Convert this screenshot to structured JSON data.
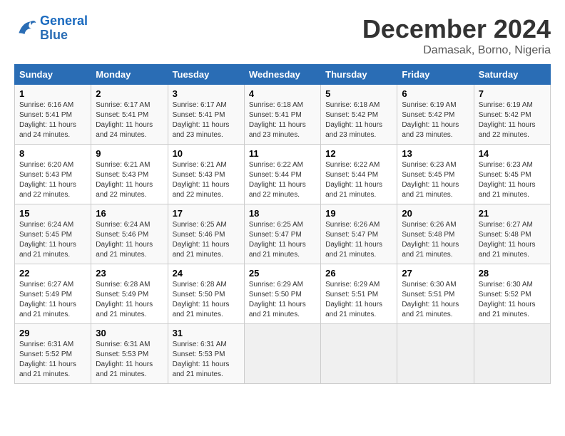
{
  "header": {
    "logo_line1": "General",
    "logo_line2": "Blue",
    "month": "December 2024",
    "location": "Damasak, Borno, Nigeria"
  },
  "calendar": {
    "days_of_week": [
      "Sunday",
      "Monday",
      "Tuesday",
      "Wednesday",
      "Thursday",
      "Friday",
      "Saturday"
    ],
    "weeks": [
      [
        {
          "day": "1",
          "info": "Sunrise: 6:16 AM\nSunset: 5:41 PM\nDaylight: 11 hours and 24 minutes."
        },
        {
          "day": "2",
          "info": "Sunrise: 6:17 AM\nSunset: 5:41 PM\nDaylight: 11 hours and 24 minutes."
        },
        {
          "day": "3",
          "info": "Sunrise: 6:17 AM\nSunset: 5:41 PM\nDaylight: 11 hours and 23 minutes."
        },
        {
          "day": "4",
          "info": "Sunrise: 6:18 AM\nSunset: 5:41 PM\nDaylight: 11 hours and 23 minutes."
        },
        {
          "day": "5",
          "info": "Sunrise: 6:18 AM\nSunset: 5:42 PM\nDaylight: 11 hours and 23 minutes."
        },
        {
          "day": "6",
          "info": "Sunrise: 6:19 AM\nSunset: 5:42 PM\nDaylight: 11 hours and 23 minutes."
        },
        {
          "day": "7",
          "info": "Sunrise: 6:19 AM\nSunset: 5:42 PM\nDaylight: 11 hours and 22 minutes."
        }
      ],
      [
        {
          "day": "8",
          "info": "Sunrise: 6:20 AM\nSunset: 5:43 PM\nDaylight: 11 hours and 22 minutes."
        },
        {
          "day": "9",
          "info": "Sunrise: 6:21 AM\nSunset: 5:43 PM\nDaylight: 11 hours and 22 minutes."
        },
        {
          "day": "10",
          "info": "Sunrise: 6:21 AM\nSunset: 5:43 PM\nDaylight: 11 hours and 22 minutes."
        },
        {
          "day": "11",
          "info": "Sunrise: 6:22 AM\nSunset: 5:44 PM\nDaylight: 11 hours and 22 minutes."
        },
        {
          "day": "12",
          "info": "Sunrise: 6:22 AM\nSunset: 5:44 PM\nDaylight: 11 hours and 21 minutes."
        },
        {
          "day": "13",
          "info": "Sunrise: 6:23 AM\nSunset: 5:45 PM\nDaylight: 11 hours and 21 minutes."
        },
        {
          "day": "14",
          "info": "Sunrise: 6:23 AM\nSunset: 5:45 PM\nDaylight: 11 hours and 21 minutes."
        }
      ],
      [
        {
          "day": "15",
          "info": "Sunrise: 6:24 AM\nSunset: 5:45 PM\nDaylight: 11 hours and 21 minutes."
        },
        {
          "day": "16",
          "info": "Sunrise: 6:24 AM\nSunset: 5:46 PM\nDaylight: 11 hours and 21 minutes."
        },
        {
          "day": "17",
          "info": "Sunrise: 6:25 AM\nSunset: 5:46 PM\nDaylight: 11 hours and 21 minutes."
        },
        {
          "day": "18",
          "info": "Sunrise: 6:25 AM\nSunset: 5:47 PM\nDaylight: 11 hours and 21 minutes."
        },
        {
          "day": "19",
          "info": "Sunrise: 6:26 AM\nSunset: 5:47 PM\nDaylight: 11 hours and 21 minutes."
        },
        {
          "day": "20",
          "info": "Sunrise: 6:26 AM\nSunset: 5:48 PM\nDaylight: 11 hours and 21 minutes."
        },
        {
          "day": "21",
          "info": "Sunrise: 6:27 AM\nSunset: 5:48 PM\nDaylight: 11 hours and 21 minutes."
        }
      ],
      [
        {
          "day": "22",
          "info": "Sunrise: 6:27 AM\nSunset: 5:49 PM\nDaylight: 11 hours and 21 minutes."
        },
        {
          "day": "23",
          "info": "Sunrise: 6:28 AM\nSunset: 5:49 PM\nDaylight: 11 hours and 21 minutes."
        },
        {
          "day": "24",
          "info": "Sunrise: 6:28 AM\nSunset: 5:50 PM\nDaylight: 11 hours and 21 minutes."
        },
        {
          "day": "25",
          "info": "Sunrise: 6:29 AM\nSunset: 5:50 PM\nDaylight: 11 hours and 21 minutes."
        },
        {
          "day": "26",
          "info": "Sunrise: 6:29 AM\nSunset: 5:51 PM\nDaylight: 11 hours and 21 minutes."
        },
        {
          "day": "27",
          "info": "Sunrise: 6:30 AM\nSunset: 5:51 PM\nDaylight: 11 hours and 21 minutes."
        },
        {
          "day": "28",
          "info": "Sunrise: 6:30 AM\nSunset: 5:52 PM\nDaylight: 11 hours and 21 minutes."
        }
      ],
      [
        {
          "day": "29",
          "info": "Sunrise: 6:31 AM\nSunset: 5:52 PM\nDaylight: 11 hours and 21 minutes."
        },
        {
          "day": "30",
          "info": "Sunrise: 6:31 AM\nSunset: 5:53 PM\nDaylight: 11 hours and 21 minutes."
        },
        {
          "day": "31",
          "info": "Sunrise: 6:31 AM\nSunset: 5:53 PM\nDaylight: 11 hours and 21 minutes."
        },
        {
          "day": "",
          "info": ""
        },
        {
          "day": "",
          "info": ""
        },
        {
          "day": "",
          "info": ""
        },
        {
          "day": "",
          "info": ""
        }
      ]
    ]
  }
}
